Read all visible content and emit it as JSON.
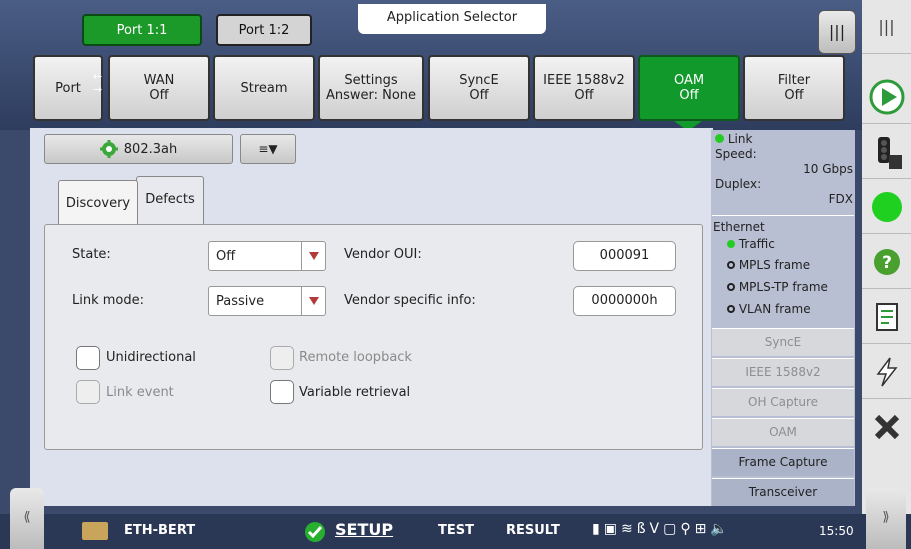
{
  "header": {
    "ports": [
      {
        "label": "Port 1:1",
        "active": true
      },
      {
        "label": "Port 1:2",
        "active": false
      }
    ],
    "app_selector": "Application Selector"
  },
  "main_tabs": [
    {
      "label": "Port",
      "sub": ""
    },
    {
      "label": "WAN",
      "sub": "Off"
    },
    {
      "label": "Stream",
      "sub": ""
    },
    {
      "label": "Settings",
      "sub": "Answer: None"
    },
    {
      "label": "SyncE",
      "sub": "Off"
    },
    {
      "label": "IEEE 1588v2",
      "sub": "Off"
    },
    {
      "label": "OAM",
      "sub": "Off"
    },
    {
      "label": "Filter",
      "sub": "Off"
    }
  ],
  "toolbar": {
    "profile_label": "802.3ah",
    "menu_icon": "list-icon"
  },
  "subtabs": [
    {
      "label": "Discovery",
      "active": true
    },
    {
      "label": "Defects",
      "active": false
    }
  ],
  "form": {
    "state_label": "State:",
    "state_value": "Off",
    "link_mode_label": "Link mode:",
    "link_mode_value": "Passive",
    "vendor_oui_label": "Vendor OUI:",
    "vendor_oui_value": "000091",
    "vendor_info_label": "Vendor specific info:",
    "vendor_info_value": "0000000h",
    "checkboxes": [
      {
        "label": "Unidirectional",
        "enabled": true,
        "checked": false
      },
      {
        "label": "Remote loopback",
        "enabled": false,
        "checked": false
      },
      {
        "label": "Link event",
        "enabled": false,
        "checked": false
      },
      {
        "label": "Variable retrieval",
        "enabled": true,
        "checked": false
      }
    ]
  },
  "side_panel": {
    "link_label": "Link",
    "speed_label": "Speed:",
    "speed_value": "10 Gbps",
    "duplex_label": "Duplex:",
    "duplex_value": "FDX",
    "ethernet_label": "Ethernet",
    "ethernet_items": [
      {
        "label": "Traffic",
        "status": "green"
      },
      {
        "label": "MPLS frame",
        "status": "off"
      },
      {
        "label": "MPLS-TP frame",
        "status": "off"
      },
      {
        "label": "VLAN frame",
        "status": "off"
      }
    ],
    "buttons": [
      {
        "label": "SyncE",
        "enabled": false
      },
      {
        "label": "IEEE 1588v2",
        "enabled": false
      },
      {
        "label": "OH Capture",
        "enabled": false
      },
      {
        "label": "OAM",
        "enabled": false
      },
      {
        "label": "Frame Capture",
        "enabled": true
      },
      {
        "label": "Transceiver",
        "enabled": true
      }
    ]
  },
  "bottom_bar": {
    "app_name": "ETH-BERT",
    "tabs": [
      "SETUP",
      "TEST",
      "RESULT"
    ],
    "active_tab": "SETUP",
    "time": "15:50"
  },
  "colors": {
    "accent_green": "#119a2b",
    "panel_bg": "#dde1ed",
    "frame_blue": "#3b4a6b"
  }
}
